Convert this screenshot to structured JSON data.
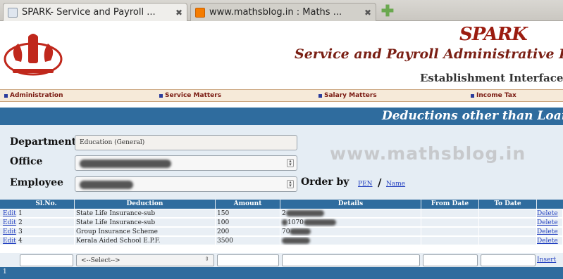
{
  "browser": {
    "tabs": [
      {
        "title": "SPARK- Service and Payroll ...",
        "active": true,
        "close": "✖"
      },
      {
        "title": "www.mathsblog.in : Maths ...",
        "active": false,
        "close": "✖"
      }
    ],
    "new_tab_glyph": "✚"
  },
  "header": {
    "logo_text": "SPARK",
    "title": "Service and Payroll Administrative Rep",
    "subtitle": "Establishment Interface"
  },
  "menu": [
    {
      "label": "Administration"
    },
    {
      "label": "Service Matters"
    },
    {
      "label": "Salary Matters"
    },
    {
      "label": "Income Tax"
    }
  ],
  "band": {
    "title": "Deductions other than Loans"
  },
  "form": {
    "department_label": "Department",
    "department_value": "Education (General)",
    "office_label": "Office",
    "employee_label": "Employee",
    "order_by_label": "Order by",
    "order_by_options": [
      "PEN",
      "Name"
    ],
    "order_by_separator": "/"
  },
  "watermark": "www.mathsblog.in",
  "table": {
    "columns": [
      "Sl.No.",
      "Deduction",
      "Amount",
      "Details",
      "From Date",
      "To Date"
    ],
    "rows": [
      {
        "edit": "Edit",
        "sl": "1",
        "deduction": "State Life Insurance-sub",
        "amount": "150",
        "details": "2",
        "from": "",
        "to": "",
        "delete": "Delete"
      },
      {
        "edit": "Edit",
        "sl": "2",
        "deduction": "State Life Insurance-sub",
        "amount": "100",
        "details": "1070",
        "from": "",
        "to": "",
        "delete": "Delete"
      },
      {
        "edit": "Edit",
        "sl": "3",
        "deduction": "Group Insurance Scheme",
        "amount": "200",
        "details": "70",
        "from": "",
        "to": "",
        "delete": "Delete"
      },
      {
        "edit": "Edit",
        "sl": "4",
        "deduction": "Kerala Aided School E.P.F.",
        "amount": "3500",
        "details": "",
        "from": "",
        "to": "",
        "delete": "Delete"
      }
    ],
    "select_placeholder": "<--Select-->",
    "insert_label": "Insert"
  },
  "footer": {
    "text": "1"
  },
  "colors": {
    "band": "#2f6c9e",
    "menu_bg": "#f6ead9",
    "title": "#7a1f14",
    "link": "#2340c0"
  }
}
